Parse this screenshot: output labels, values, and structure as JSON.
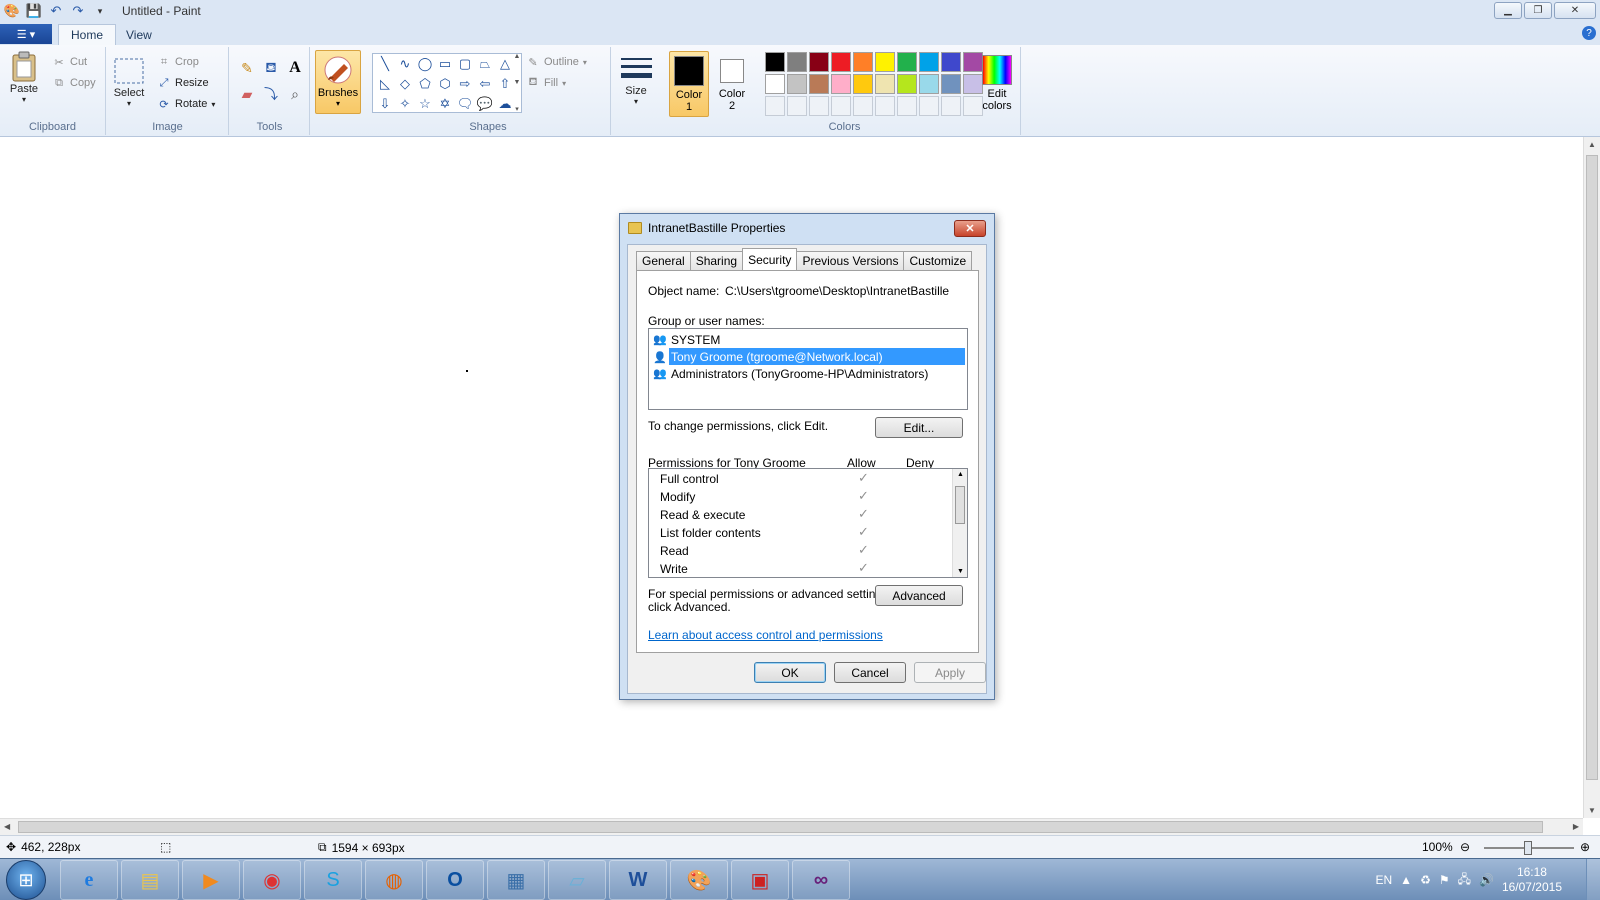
{
  "window": {
    "title": "Untitled - Paint",
    "controls": {
      "minimize": "▁",
      "maximize": "❐",
      "close": "✕"
    }
  },
  "ribbon": {
    "file_menu": "☰ ▾",
    "tabs": [
      {
        "label": "Home",
        "active": true
      },
      {
        "label": "View",
        "active": false
      }
    ],
    "groups": {
      "clipboard": {
        "label": "Clipboard",
        "paste": "Paste",
        "cut": "Cut",
        "copy": "Copy"
      },
      "image": {
        "label": "Image",
        "select": "Select",
        "crop": "Crop",
        "resize": "Resize",
        "rotate": "Rotate"
      },
      "tools": {
        "label": "Tools"
      },
      "brushes": {
        "label": "Brushes"
      },
      "shapes": {
        "label": "Shapes",
        "outline": "Outline",
        "fill": "Fill"
      },
      "size": {
        "label": "Size"
      },
      "colors": {
        "label": "Colors",
        "color1_line1": "Color",
        "color1_line2": "1",
        "color2_line1": "Color",
        "color2_line2": "2",
        "edit_line1": "Edit",
        "edit_line2": "colors",
        "color1": "#000000",
        "color2": "#ffffff",
        "palette": [
          "#000000",
          "#7f7f7f",
          "#880015",
          "#ed1c24",
          "#ff7f27",
          "#fff200",
          "#22b14c",
          "#00a2e8",
          "#3f48cc",
          "#a349a4",
          "#ffffff",
          "#c3c3c3",
          "#b97a57",
          "#ffaec9",
          "#ffc90e",
          "#efe4b0",
          "#b5e61d",
          "#99d9ea",
          "#7092be",
          "#c8bfe7",
          "",
          "",
          "",
          "",
          "",
          "",
          "",
          "",
          "",
          ""
        ]
      }
    }
  },
  "status": {
    "cursor_pos": "462, 228px",
    "canvas_size": "1594 × 693px",
    "zoom": "100%"
  },
  "dialog": {
    "title": "IntranetBastille Properties",
    "tabs": [
      "General",
      "Sharing",
      "Security",
      "Previous Versions",
      "Customize"
    ],
    "object_name_label": "Object name:",
    "object_name_value": "C:\\Users\\tgroome\\Desktop\\IntranetBastille",
    "group_label": "Group or user names:",
    "users": [
      {
        "name": "SYSTEM",
        "selected": false
      },
      {
        "name": "Tony Groome (tgroome@Network.local)",
        "selected": true
      },
      {
        "name": "Administrators (TonyGroome-HP\\Administrators)",
        "selected": false
      }
    ],
    "change_text": "To change permissions, click Edit.",
    "edit_button": "Edit...",
    "permissions_for": "Permissions for Tony Groome",
    "allow_header": "Allow",
    "deny_header": "Deny",
    "permissions": [
      {
        "name": "Full control",
        "allow": "✓"
      },
      {
        "name": "Modify",
        "allow": "✓"
      },
      {
        "name": "Read & execute",
        "allow": "✓"
      },
      {
        "name": "List folder contents",
        "allow": "✓"
      },
      {
        "name": "Read",
        "allow": "✓"
      },
      {
        "name": "Write",
        "allow": "✓"
      }
    ],
    "special_text_1": "For special permissions or advanced settings,",
    "special_text_2": "click Advanced.",
    "advanced_button": "Advanced",
    "learn_link": "Learn about access control and permissions",
    "ok": "OK",
    "cancel": "Cancel",
    "apply": "Apply"
  },
  "taskbar": {
    "language": "EN",
    "time": "16:18",
    "date": "16/07/2015"
  }
}
